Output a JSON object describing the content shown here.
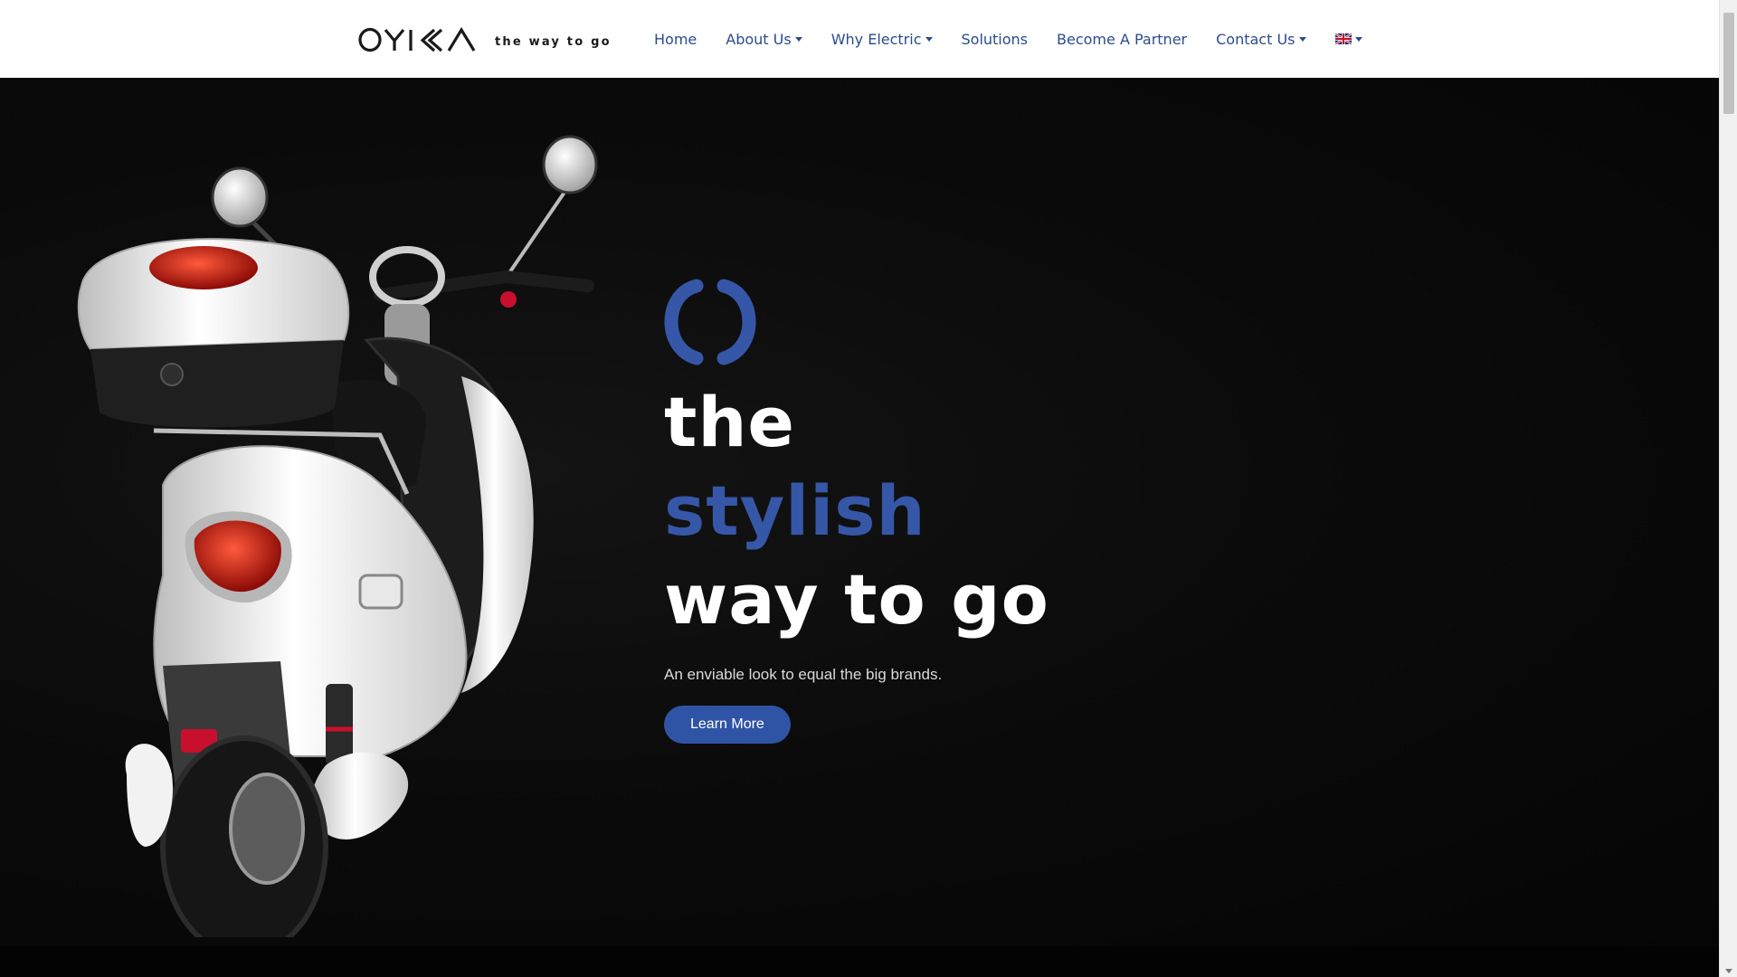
{
  "brand": {
    "logo_text": "OYIKA",
    "tagline": "the way to go"
  },
  "nav": {
    "items": [
      {
        "label": "Home",
        "has_dropdown": false
      },
      {
        "label": "About Us",
        "has_dropdown": true
      },
      {
        "label": "Why Electric",
        "has_dropdown": true
      },
      {
        "label": "Solutions",
        "has_dropdown": false
      },
      {
        "label": "Become A Partner",
        "has_dropdown": false
      },
      {
        "label": "Contact Us",
        "has_dropdown": true
      }
    ],
    "language_icon": "uk-flag-icon"
  },
  "hero": {
    "line1": "the",
    "line2": "stylish",
    "line3": "way to go",
    "subtitle": "An enviable look to equal the big brands.",
    "cta_label": "Learn More"
  },
  "colors": {
    "accent": "#3657a8",
    "button": "#2f54a6",
    "nav_text": "#2b4c8c",
    "hero_bg": "#0a0a0a"
  }
}
